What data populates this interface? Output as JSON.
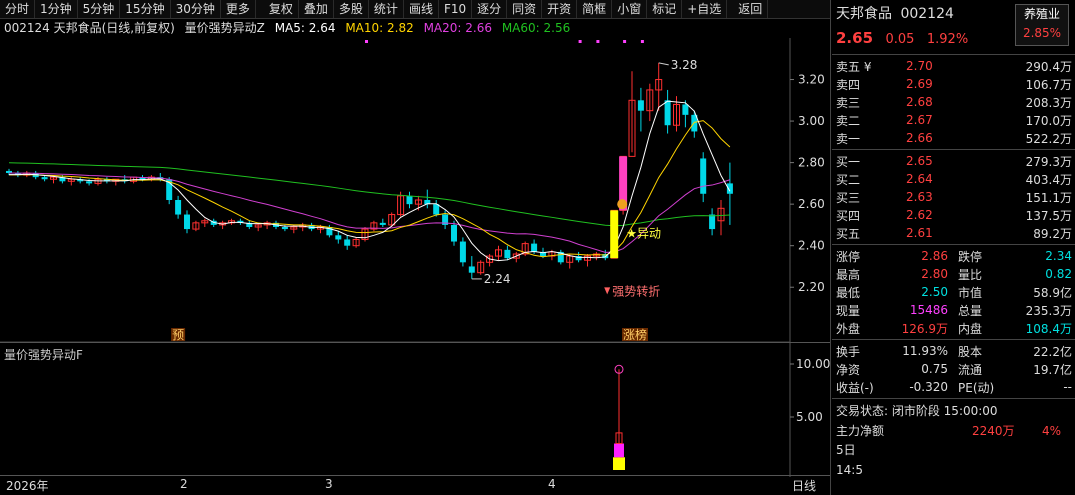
{
  "toolbar": {
    "left": [
      "分时",
      "1分钟",
      "5分钟",
      "15分钟",
      "30分钟",
      "更多"
    ],
    "mid": [
      "复权",
      "叠加",
      "多股",
      "统计",
      "画线",
      "F10",
      "逐分",
      "同资",
      "开资",
      "简框",
      "小窗",
      "标记",
      "+自选"
    ],
    "back": "返回"
  },
  "header": {
    "code_name": "002124 天邦食品(日线,前复权)",
    "indicator": "量价强势异动Z",
    "ma5": "MA5: 2.64",
    "ma10": "MA10: 2.82",
    "ma20": "MA20: 2.66",
    "ma60": "MA60: 2.56"
  },
  "colors": {
    "up": "#ff3030",
    "down": "#00d8e8",
    "ma5": "#ffffff",
    "ma10": "#ffd400",
    "ma20": "#d040d0",
    "ma60": "#20c020"
  },
  "annotations": {
    "high": "3.28",
    "low": "2.24",
    "signal": "★异动",
    "turn": "强势转折",
    "pre": "预",
    "zt": "涨榜"
  },
  "sub": {
    "title": "量价强势异动F",
    "ticks": [
      "10.00",
      "5.00"
    ]
  },
  "xaxis": {
    "labels": [
      "2026年",
      "2",
      "3",
      "4",
      "日线"
    ]
  },
  "panel": {
    "name": "天邦食品",
    "code": "002124",
    "sector": "养殖业",
    "sector_pct": "2.85%",
    "price": "2.65",
    "change": "0.05",
    "pct": "1.92%",
    "asks": [
      {
        "label": "卖五 ¥",
        "price": "2.70",
        "vol": "290.4万"
      },
      {
        "label": "卖四",
        "price": "2.69",
        "vol": "106.7万"
      },
      {
        "label": "卖三",
        "price": "2.68",
        "vol": "208.3万"
      },
      {
        "label": "卖二",
        "price": "2.67",
        "vol": "170.0万"
      },
      {
        "label": "卖一",
        "price": "2.66",
        "vol": "522.2万"
      }
    ],
    "bids": [
      {
        "label": "买一",
        "price": "2.65",
        "vol": "279.3万"
      },
      {
        "label": "买二",
        "price": "2.64",
        "vol": "403.4万"
      },
      {
        "label": "买三",
        "price": "2.63",
        "vol": "151.1万"
      },
      {
        "label": "买四",
        "price": "2.62",
        "vol": "137.5万"
      },
      {
        "label": "买五",
        "price": "2.61",
        "vol": "89.2万"
      }
    ],
    "stats": [
      {
        "l1": "涨停",
        "v1": "2.86",
        "c1": "red",
        "l2": "跌停",
        "v2": "2.34",
        "c2": "green"
      },
      {
        "l1": "最高",
        "v1": "2.80",
        "c1": "red",
        "l2": "量比",
        "v2": "0.82",
        "c2": "green"
      },
      {
        "l1": "最低",
        "v1": "2.50",
        "c1": "green",
        "l2": "市值",
        "v2": "58.9亿",
        "c2": "white"
      },
      {
        "l1": "现量",
        "v1": "15486",
        "c1": "mag",
        "l2": "总量",
        "v2": "235.3万",
        "c2": "white"
      },
      {
        "l1": "外盘",
        "v1": "126.9万",
        "c1": "red",
        "l2": "内盘",
        "v2": "108.4万",
        "c2": "green"
      }
    ],
    "stats2": [
      {
        "l1": "换手",
        "v1": "11.93%",
        "l2": "股本",
        "v2": "22.2亿"
      },
      {
        "l1": "净资",
        "v1": "0.75",
        "l2": "流通",
        "v2": "19.7亿"
      },
      {
        "l1": "收益(-)",
        "v1": "-0.320",
        "l2": "PE(动)",
        "v2": "--"
      }
    ],
    "trade_status": "交易状态: 闭市阶段 15:00:00",
    "main_flow_label": "主力净额",
    "main_flow": "2240万",
    "main_flow_pct": "4%",
    "day5": "5日",
    "time": "14:5"
  },
  "chart_data": {
    "type": "candlestick",
    "ylim": [
      2.1,
      3.4
    ],
    "yticks": [
      "3.20",
      "3.00",
      "2.80",
      "2.60",
      "2.40",
      "2.20"
    ],
    "candles": [
      [
        2.76,
        2.77,
        2.74,
        2.75
      ],
      [
        2.75,
        2.76,
        2.73,
        2.74
      ],
      [
        2.74,
        2.76,
        2.73,
        2.75
      ],
      [
        2.75,
        2.76,
        2.72,
        2.73
      ],
      [
        2.73,
        2.74,
        2.71,
        2.72
      ],
      [
        2.72,
        2.74,
        2.7,
        2.73
      ],
      [
        2.73,
        2.74,
        2.7,
        2.71
      ],
      [
        2.71,
        2.73,
        2.69,
        2.72
      ],
      [
        2.72,
        2.73,
        2.7,
        2.71
      ],
      [
        2.71,
        2.72,
        2.69,
        2.7
      ],
      [
        2.7,
        2.73,
        2.69,
        2.72
      ],
      [
        2.72,
        2.73,
        2.7,
        2.71
      ],
      [
        2.71,
        2.72,
        2.69,
        2.72
      ],
      [
        2.72,
        2.74,
        2.7,
        2.71
      ],
      [
        2.71,
        2.73,
        2.7,
        2.73
      ],
      [
        2.73,
        2.74,
        2.71,
        2.72
      ],
      [
        2.72,
        2.74,
        2.71,
        2.73
      ],
      [
        2.73,
        2.75,
        2.71,
        2.72
      ],
      [
        2.72,
        2.73,
        2.6,
        2.62
      ],
      [
        2.62,
        2.64,
        2.53,
        2.55
      ],
      [
        2.55,
        2.57,
        2.46,
        2.48
      ],
      [
        2.48,
        2.52,
        2.47,
        2.51
      ],
      [
        2.51,
        2.53,
        2.49,
        2.52
      ],
      [
        2.52,
        2.53,
        2.49,
        2.5
      ],
      [
        2.5,
        2.52,
        2.48,
        2.51
      ],
      [
        2.51,
        2.53,
        2.5,
        2.52
      ],
      [
        2.52,
        2.53,
        2.5,
        2.51
      ],
      [
        2.51,
        2.52,
        2.48,
        2.49
      ],
      [
        2.49,
        2.51,
        2.47,
        2.5
      ],
      [
        2.5,
        2.52,
        2.48,
        2.51
      ],
      [
        2.51,
        2.52,
        2.48,
        2.49
      ],
      [
        2.49,
        2.5,
        2.47,
        2.48
      ],
      [
        2.48,
        2.5,
        2.46,
        2.49
      ],
      [
        2.49,
        2.51,
        2.47,
        2.5
      ],
      [
        2.5,
        2.51,
        2.47,
        2.48
      ],
      [
        2.48,
        2.5,
        2.46,
        2.49
      ],
      [
        2.49,
        2.5,
        2.44,
        2.45
      ],
      [
        2.45,
        2.47,
        2.41,
        2.43
      ],
      [
        2.43,
        2.45,
        2.38,
        2.4
      ],
      [
        2.4,
        2.44,
        2.39,
        2.43
      ],
      [
        2.43,
        2.49,
        2.42,
        2.48
      ],
      [
        2.48,
        2.52,
        2.47,
        2.51
      ],
      [
        2.51,
        2.53,
        2.49,
        2.5
      ],
      [
        2.5,
        2.56,
        2.49,
        2.55
      ],
      [
        2.55,
        2.66,
        2.54,
        2.64
      ],
      [
        2.64,
        2.66,
        2.58,
        2.6
      ],
      [
        2.6,
        2.64,
        2.57,
        2.62
      ],
      [
        2.62,
        2.67,
        2.58,
        2.6
      ],
      [
        2.6,
        2.62,
        2.54,
        2.55
      ],
      [
        2.55,
        2.57,
        2.48,
        2.5
      ],
      [
        2.5,
        2.52,
        2.4,
        2.42
      ],
      [
        2.42,
        2.44,
        2.3,
        2.32
      ],
      [
        2.3,
        2.35,
        2.24,
        2.27
      ],
      [
        2.27,
        2.33,
        2.26,
        2.32
      ],
      [
        2.32,
        2.36,
        2.3,
        2.35
      ],
      [
        2.35,
        2.4,
        2.33,
        2.38
      ],
      [
        2.38,
        2.4,
        2.33,
        2.34
      ],
      [
        2.34,
        2.37,
        2.32,
        2.36
      ],
      [
        2.36,
        2.42,
        2.35,
        2.41
      ],
      [
        2.41,
        2.43,
        2.36,
        2.37
      ],
      [
        2.37,
        2.39,
        2.34,
        2.35
      ],
      [
        2.35,
        2.38,
        2.33,
        2.37
      ],
      [
        2.37,
        2.38,
        2.31,
        2.32
      ],
      [
        2.32,
        2.36,
        2.29,
        2.35
      ],
      [
        2.35,
        2.37,
        2.32,
        2.33
      ],
      [
        2.33,
        2.36,
        2.3,
        2.35
      ],
      [
        2.35,
        2.37,
        2.33,
        2.36
      ],
      [
        2.36,
        2.38,
        2.33,
        2.34
      ],
      [
        2.34,
        2.57,
        2.34,
        2.57
      ],
      [
        2.57,
        2.83,
        2.55,
        2.83
      ],
      [
        2.83,
        3.24,
        2.85,
        3.1
      ],
      [
        3.1,
        3.16,
        2.95,
        3.05
      ],
      [
        3.05,
        3.18,
        3.0,
        3.15
      ],
      [
        3.15,
        3.28,
        3.05,
        3.2
      ],
      [
        3.1,
        3.15,
        2.94,
        2.98
      ],
      [
        2.98,
        3.12,
        2.95,
        3.08
      ],
      [
        3.08,
        3.1,
        2.97,
        3.03
      ],
      [
        3.03,
        3.05,
        2.92,
        2.95
      ],
      [
        2.82,
        2.85,
        2.61,
        2.65
      ],
      [
        2.55,
        2.58,
        2.45,
        2.48
      ],
      [
        2.52,
        2.62,
        2.45,
        2.58
      ],
      [
        2.7,
        2.8,
        2.5,
        2.65
      ]
    ]
  }
}
